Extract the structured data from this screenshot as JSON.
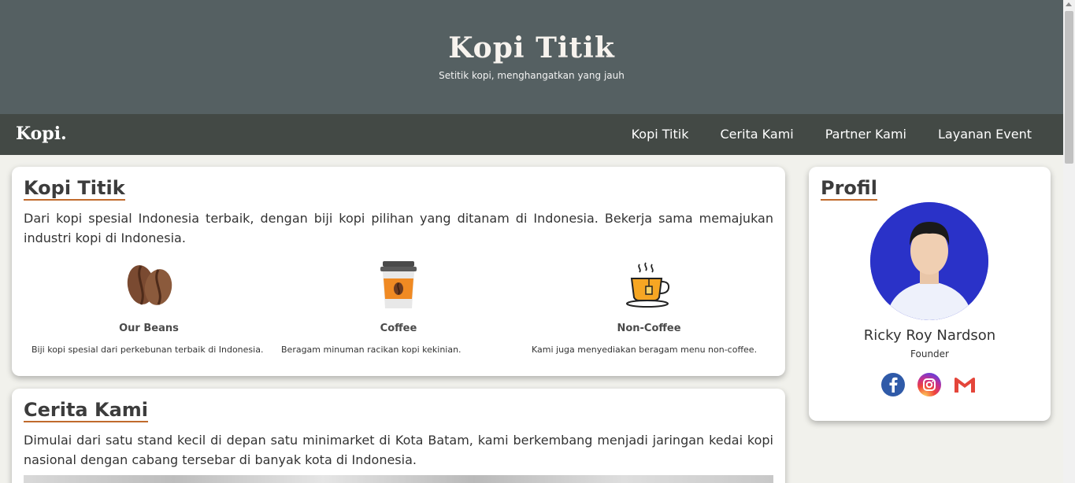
{
  "hero": {
    "title": "Kopi Titik",
    "tagline": "Setitik kopi, menghangatkan yang jauh"
  },
  "nav": {
    "logo": "Kopi.",
    "links": [
      "Kopi Titik",
      "Cerita Kami",
      "Partner Kami",
      "Layanan Event"
    ]
  },
  "section_kopi": {
    "heading": "Kopi Titik",
    "text": "Dari kopi spesial Indonesia terbaik, dengan biji kopi pilihan yang ditanam di Indonesia. Bekerja sama memajukan industri kopi di Indonesia.",
    "features": [
      {
        "title": "Our Beans",
        "desc": "Biji kopi spesial dari perkebunan terbaik di Indonesia.",
        "icon": "coffee-beans-icon"
      },
      {
        "title": "Coffee",
        "desc": "Beragam minuman racikan kopi kekinian.",
        "icon": "coffee-cup-icon"
      },
      {
        "title": "Non-Coffee",
        "desc": "Kami juga menyediakan beragam menu non-coffee.",
        "icon": "tea-cup-icon"
      }
    ]
  },
  "section_cerita": {
    "heading": "Cerita Kami",
    "text": "Dimulai dari satu stand kecil di depan satu minimarket di Kota Batam, kami berkembang menjadi jaringan kedai kopi nasional dengan cabang tersebar di banyak kota di Indonesia."
  },
  "profile": {
    "heading": "Profil",
    "name": "Ricky Roy Nardson",
    "role": "Founder",
    "socials": [
      "facebook-icon",
      "instagram-icon",
      "gmail-icon"
    ]
  },
  "colors": {
    "hero_bg": "#556062",
    "nav_bg": "#434945",
    "accent": "#c06a2c",
    "page_bg": "#f1f1ec"
  }
}
